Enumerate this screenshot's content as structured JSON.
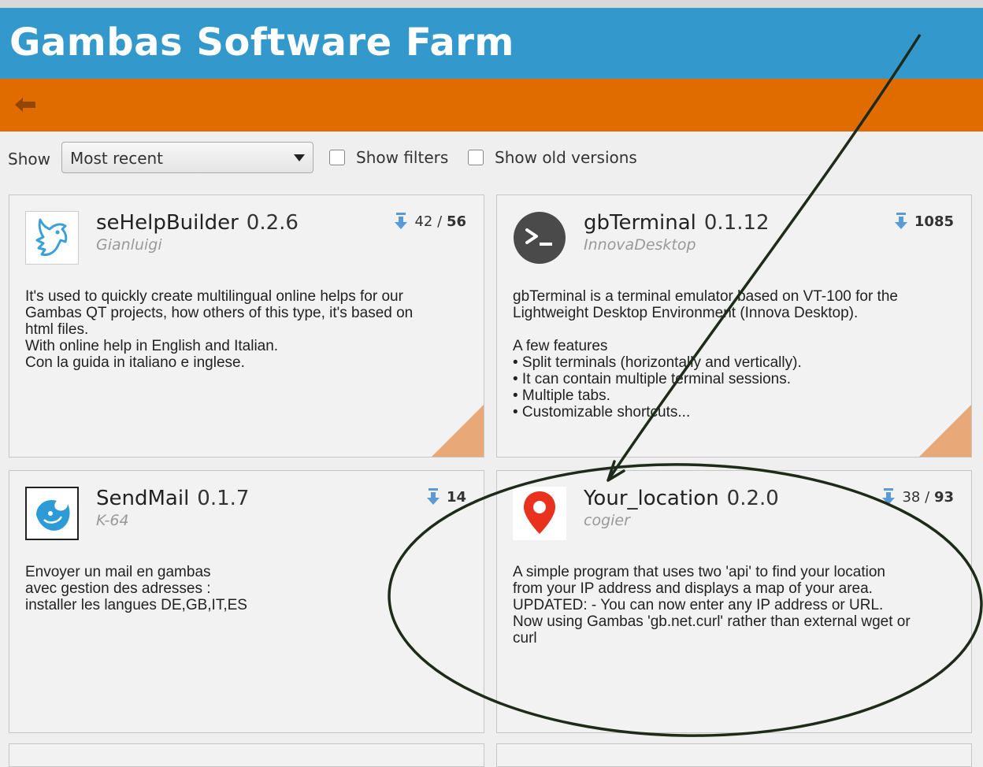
{
  "app": {
    "title": "Gambas Software Farm"
  },
  "toolbar": {
    "show_label": "Show",
    "sort_select": {
      "selected": "Most recent"
    },
    "show_filters_label": "Show filters",
    "show_old_versions_label": "Show old versions"
  },
  "colors": {
    "title_bar": "#3399cc",
    "nav_bar": "#e06c00",
    "card_corner": "#e8a877",
    "download_icon": "#5b9bd5"
  },
  "cards": [
    {
      "name": "seHelpBuilder",
      "version": "0.2.6",
      "author": "Gianluigi",
      "downloads_current": "42",
      "downloads_sep": "/",
      "downloads_total": "56",
      "icon": "goat-icon",
      "description": "It's used to quickly create multilingual online helps for our\nGambas QT projects, how others of this type, it's based on\nhtml files.\nWith online help in English and Italian.\nCon la guida in italiano e inglese."
    },
    {
      "name": "gbTerminal",
      "version": "0.1.12",
      "author": "InnovaDesktop",
      "downloads_total": "1085",
      "icon": "terminal-icon",
      "description": "gbTerminal is a terminal emulator based on VT-100 for the\nLightweight Desktop Environment (Innova Desktop).\n\nA few features\n • Split terminals (horizontally and vertically).\n • It can contain multiple terminal sessions.\n • Multiple tabs.\n • Customizable shortcuts..."
    },
    {
      "name": "SendMail",
      "version": "0.1.7",
      "author": "K-64",
      "downloads_total": "14",
      "icon": "mail-bird-icon",
      "description": "Envoyer un mail en gambas\navec gestion des adresses :\ninstaller les langues DE,GB,IT,ES"
    },
    {
      "name": "Your_location",
      "version": "0.2.0",
      "author": "cogier",
      "downloads_current": "38",
      "downloads_sep": "/",
      "downloads_total": "93",
      "icon": "map-pin-icon",
      "description": "A simple program that uses two 'api' to find your location\nfrom your IP address and displays a map of your area.\nUPDATED: - You can now enter any IP address or URL.\nNow using Gambas 'gb.net.curl' rather than external wget or\ncurl"
    }
  ]
}
